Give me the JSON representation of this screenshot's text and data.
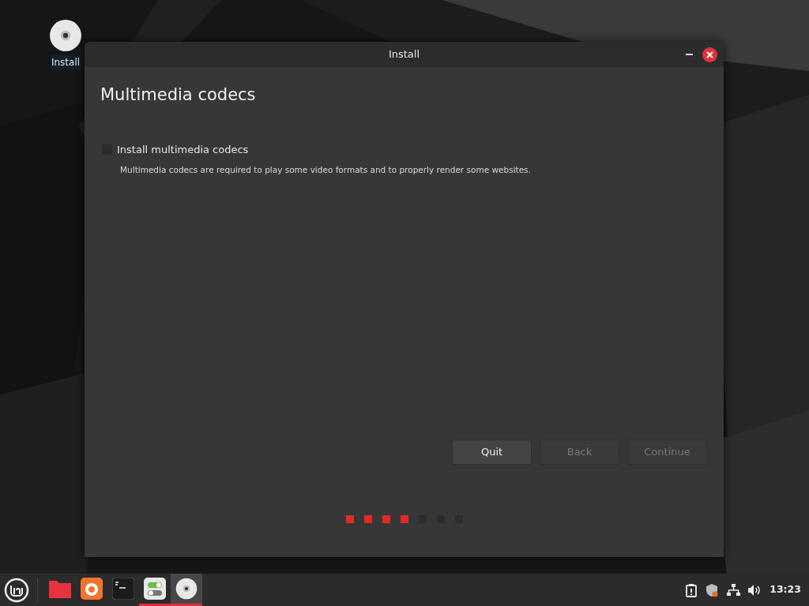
{
  "desktop_icons": [
    {
      "label": "Install"
    }
  ],
  "window": {
    "title": "Install",
    "heading": "Multimedia codecs",
    "option": {
      "label": "Install multimedia codecs",
      "checked": false,
      "description": "Multimedia codecs are required to play some video formats and to properly render some websites."
    },
    "buttons": [
      {
        "label": "Quit",
        "disabled": false
      },
      {
        "label": "Back",
        "disabled": true
      },
      {
        "label": "Continue",
        "disabled": true
      }
    ],
    "steps": [
      {
        "done": true
      },
      {
        "done": true
      },
      {
        "done": true
      },
      {
        "done": true
      },
      {
        "done": false
      },
      {
        "done": false
      },
      {
        "done": false
      }
    ]
  },
  "taskbar": {
    "items": [
      {
        "kind": "files",
        "running": false,
        "focused": false
      },
      {
        "kind": "firefox",
        "running": false,
        "focused": false
      },
      {
        "kind": "terminal",
        "running": false,
        "focused": false
      },
      {
        "kind": "settings",
        "running": true,
        "focused": false
      },
      {
        "kind": "disc",
        "running": true,
        "focused": true
      }
    ],
    "clock": "13:23"
  }
}
